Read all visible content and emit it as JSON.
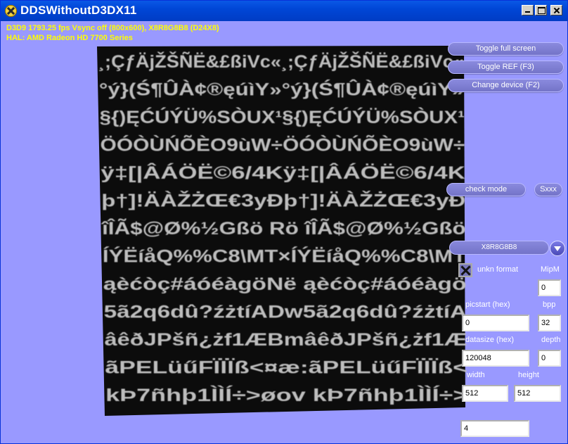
{
  "window": {
    "title": "DDSWithoutD3DX11"
  },
  "stats": {
    "line1": "D3D9 1793.25 fps Vsync off (800x600), X8R8G8B8 (D24X8)",
    "line2": "HAL: AMD Radeon HD 7700 Series"
  },
  "buttons": {
    "toggle_full_screen": "Toggle full screen",
    "toggle_ref": "Toggle REF (F3)",
    "change_device": "Change device (F2)",
    "check_mode": "check mode",
    "sxxx": "Sxxx"
  },
  "format_combo": {
    "selected": "X8R8G8B8"
  },
  "unkn_format": {
    "label": "unkn format",
    "checked": true
  },
  "fields": {
    "mipm": {
      "label": "MipM",
      "value": "0"
    },
    "picstart": {
      "label": "picstart  (hex)",
      "value": "0"
    },
    "bpp": {
      "label": "bpp",
      "value": "32"
    },
    "datasize": {
      "label": "datasize  (hex)",
      "value": "120048"
    },
    "depth": {
      "label": "depth",
      "value": "0"
    },
    "width": {
      "label": "width",
      "value": "512"
    },
    "height": {
      "label": "height",
      "value": "512"
    },
    "extra": {
      "value": "4"
    }
  },
  "texture_rows": [
    "¸;ÇƒÄjŽŠÑË&£ßiVc«¸;ÇƒÄjŽŠÑË&£ßiVc«",
    "°ý}(Ś¶ÛÀ¢®ęúìY»°ý}(Ś¶ÛÀ¢®ęúìY»",
    "§{)ĘĆÚÝÜ%SÒUX¹§{)ĘĆÚÝÜ%SÒUX¹",
    "ÖÓÒÙŃÕÈO9ùW÷ÖÓÒÙŃÕÈO9ùW÷",
    "ÿ‡[|ÂÁÖË©6/4Kÿ‡[|ÂÁÖË©6/4K",
    "þ†]!ÄÀŽŻŒ€3yĐþ†]!ÄÀŽŻŒ€3yĐ",
    "îÎÃ$@Ø%½Gßö Rö îÎÃ$@Ø%½Gßö",
    "ÍÝËíåQ%%C8\\MT×ÍÝËíåQ%%C8\\MT",
    "ąèćòç#áóéàgöNë ąèćòç#áóéàgö",
    "5ã2q6dû?źżtíADw5ã2q6dû?źżtíA",
    "âêðJPšñ¿żf1ÆBmâêðJPšñ¿żf1Æ",
    "ãPELüűFÏÏÏß<¤æ:ãPELüűFÏÏÏß<",
    "kÞ7ñhþ1ÌÌÍ÷>øov kÞ7ñhþ1ÌÌÍ÷>"
  ]
}
